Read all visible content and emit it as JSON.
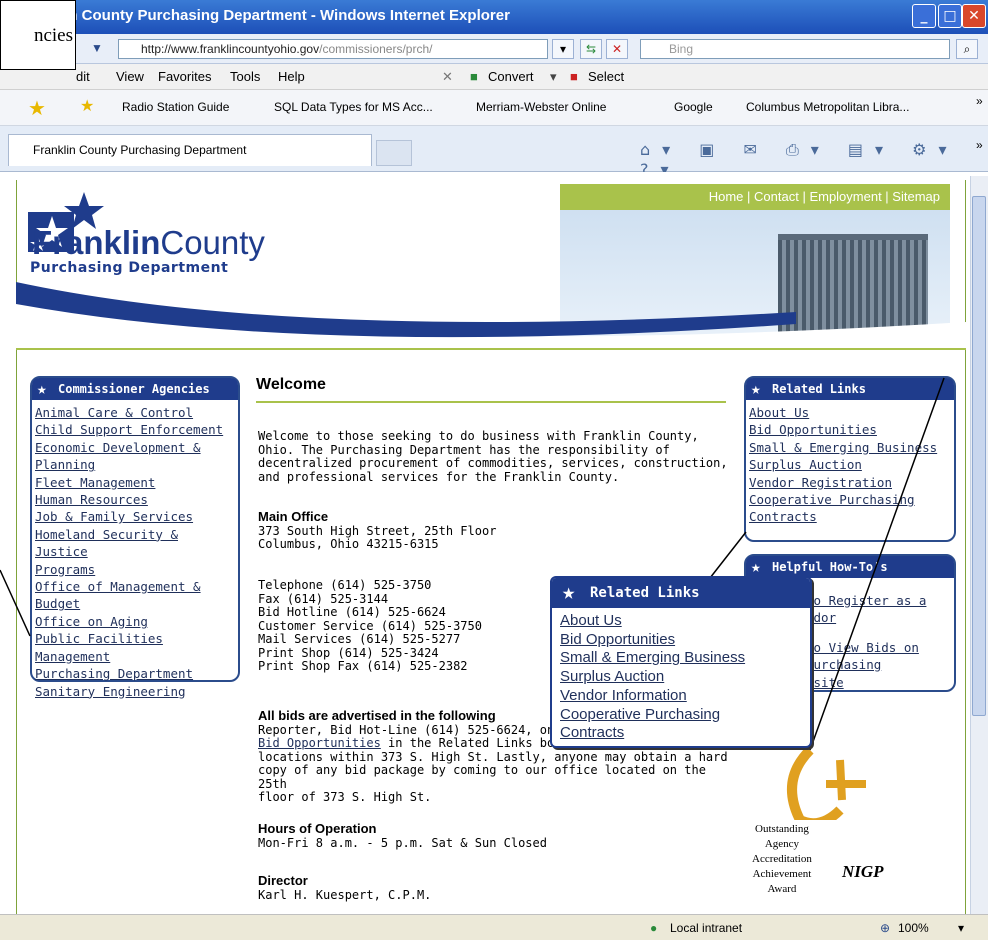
{
  "window": {
    "title": "lin County Purchasing Department - Windows Internet Explorer",
    "minimize": "_",
    "maximize": "□",
    "close": "✕"
  },
  "address": {
    "url_main": "http://www.franklincountyohio.gov",
    "url_path": "/commissioners/prch/",
    "search_placeholder": "Bing"
  },
  "menu": [
    "dit",
    "View",
    "Favorites",
    "Tools",
    "Help"
  ],
  "menu_extra": {
    "convert": "Convert",
    "select": "Select"
  },
  "favorites": [
    "Radio Station Guide",
    "SQL Data Types for MS Acc...",
    "Merriam-Webster Online",
    "Google",
    "Columbus Metropolitan Libra..."
  ],
  "tab": {
    "title": "Franklin County Purchasing Department"
  },
  "callout_left_text": "ncies",
  "site": {
    "topnav": [
      "Home",
      "Contact",
      "Employment",
      "Sitemap"
    ],
    "topnav_sep": " | ",
    "logo_franklin": "Franklin",
    "logo_county": "County",
    "logo_sub": "Purchasing Department"
  },
  "left_panel": {
    "title": "Commissioner Agencies",
    "items": [
      "Animal Care & Control",
      "Child Support Enforcement",
      "Economic Development &",
      "Planning",
      "Fleet Management",
      "Human Resources",
      "Job & Family Services",
      "Homeland Security & Justice",
      "Programs",
      "Office of Management &",
      "Budget",
      "Office on Aging",
      "Public Facilities Management",
      "Purchasing Department",
      "Sanitary Engineering"
    ]
  },
  "main": {
    "heading": "Welcome",
    "intro": "Welcome to those seeking to do business with Franklin County, Ohio. The Purchasing Department has the responsibility of decentralized procurement of commodities, services, construction, and professional services for the Franklin County.",
    "main_office_label": "Main Office",
    "address1": "373 South High Street, 25th Floor",
    "address2": "Columbus, Ohio 43215-6315",
    "phones": [
      "Telephone (614) 525-3750",
      "Fax (614) 525-3144",
      "Bid Hotline (614) 525-6624",
      "Customer Service (614) 525-3750",
      "Mail Services (614) 525-5277",
      "Print Shop (614) 525-3424",
      "Print Shop Fax (614) 525-2382"
    ],
    "bids_label": "All bids are advertised in the following",
    "bids_line1": "Reporter, Bid Hot-Line (614) 525-6624, on",
    "bids_link": "Bid Opportunities",
    "bids_line2": " in the Related Links box t",
    "bids_line3": "locations within 373 S. High St. Lastly, anyone may obtain a hard",
    "bids_line4": "copy of any bid package by coming to our office located on the 25th",
    "bids_line5": "floor of 373 S. High St.",
    "hours_label": "Hours of Operation",
    "hours": "Mon-Fri 8 a.m. - 5 p.m. Sat & Sun Closed",
    "director_label": "Director",
    "director": "Karl H. Kuespert, C.P.M."
  },
  "related_panel": {
    "title": "Related Links",
    "items": [
      "About Us",
      "Bid Opportunities",
      "Small & Emerging Business",
      "Surplus Auction",
      "Vendor Registration",
      "Cooperative Purchasing",
      "Contracts"
    ]
  },
  "howto_panel": {
    "title": "Helpful How-To's",
    "items": [
      "To Register as a",
      "ndor",
      "To View Bids on",
      "Purchasing",
      "bsite"
    ]
  },
  "zoom_panel": {
    "title": "Related Links",
    "items": [
      "About Us",
      "Bid Opportunities",
      "Small & Emerging Business",
      "Surplus Auction",
      "Vendor Information",
      "Cooperative Purchasing",
      "Contracts"
    ]
  },
  "award": {
    "lines": [
      "Outstanding",
      "Agency",
      "Accreditation",
      "Achievement",
      "Award"
    ],
    "nigp": "NIGP"
  },
  "status": {
    "zone": "Local intranet",
    "zoom": "100%"
  }
}
